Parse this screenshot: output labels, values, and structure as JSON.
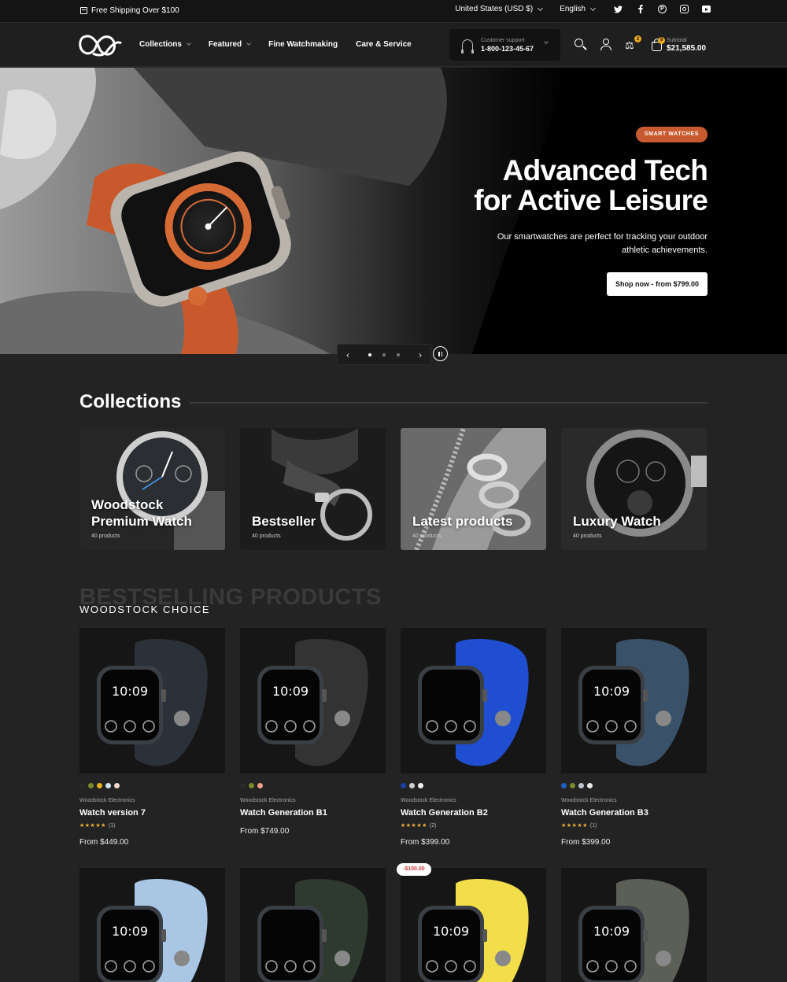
{
  "topbar": {
    "shipping": "Free Shipping Over $100",
    "currency": "United States (USD $)",
    "language": "English",
    "social": [
      "twitter-icon",
      "facebook-icon",
      "pinterest-icon",
      "instagram-icon",
      "youtube-icon"
    ]
  },
  "header": {
    "nav": [
      {
        "label": "Collections",
        "dropdown": true
      },
      {
        "label": "Featured",
        "dropdown": true
      },
      {
        "label": "Fine Watchmaking",
        "dropdown": false
      },
      {
        "label": "Care & Service",
        "dropdown": false
      }
    ],
    "support_label": "Customer support",
    "support_phone": "1-800-123-45-67",
    "compare_count": "2",
    "cart_count": "9",
    "subtotal_label": "Subtotal",
    "subtotal_value": "$21,585.00"
  },
  "hero": {
    "tag": "SMART WATCHES",
    "title_line1": "Advanced Tech",
    "title_line2": "for Active Leisure",
    "subtitle": "Our smartwatches are perfect for tracking your outdoor athletic achievements.",
    "cta": "Shop now - from $799.00",
    "slide_count": 3,
    "active_slide": 1
  },
  "collections": {
    "title": "Collections",
    "items": [
      {
        "name_line1": "Woodstock",
        "name_line2": "Premium Watch",
        "count": "40 products"
      },
      {
        "name_line1": "",
        "name_line2": "Bestseller",
        "count": "40 products"
      },
      {
        "name_line1": "",
        "name_line2": "Latest products",
        "count": "40 products"
      },
      {
        "name_line1": "",
        "name_line2": "Luxury Watch",
        "count": "40 products"
      }
    ]
  },
  "bestselling": {
    "ghost_title": "BESTSELLING PRODUCTS",
    "subtitle": "WOODSTOCK CHOICE",
    "products": [
      {
        "vendor": "Woodstock Electronics",
        "name": "Watch version 7",
        "rating_count": "(1)",
        "price": "From $449.00",
        "swatches": [
          "#2a2a2a",
          "#7a8a2a",
          "#e8b21f",
          "#cfe0f2",
          "#f1d8cf"
        ],
        "band": "#2b3138"
      },
      {
        "vendor": "Woodstock Electronics",
        "name": "Watch Generation B1",
        "rating_count": "",
        "price": "From $749.00",
        "swatches": [
          "#2a2a2a",
          "#7a8a2a",
          "#f1a08a"
        ],
        "band": "#333333"
      },
      {
        "vendor": "Woodstock Electronics",
        "name": "Watch Generation B2",
        "rating_count": "(2)",
        "price": "From $399.00",
        "swatches": [
          "#1d3fa8",
          "#cfcfcf",
          "#f2f2f2"
        ],
        "band": "#1f4fd0"
      },
      {
        "vendor": "Woodstock Electronics",
        "name": "Watch Generation B3",
        "rating_count": "(1)",
        "price": "From $399.00",
        "swatches": [
          "#1e5fc0",
          "#7a8a2a",
          "#bfc6d0",
          "#e8e8e8"
        ],
        "band": "#3a5269"
      }
    ],
    "row2_bands": [
      "#a9c6e4",
      "#2e3a2e",
      "#f2de4a",
      "#5b5f56"
    ],
    "sale_badge": "-$100.00"
  }
}
